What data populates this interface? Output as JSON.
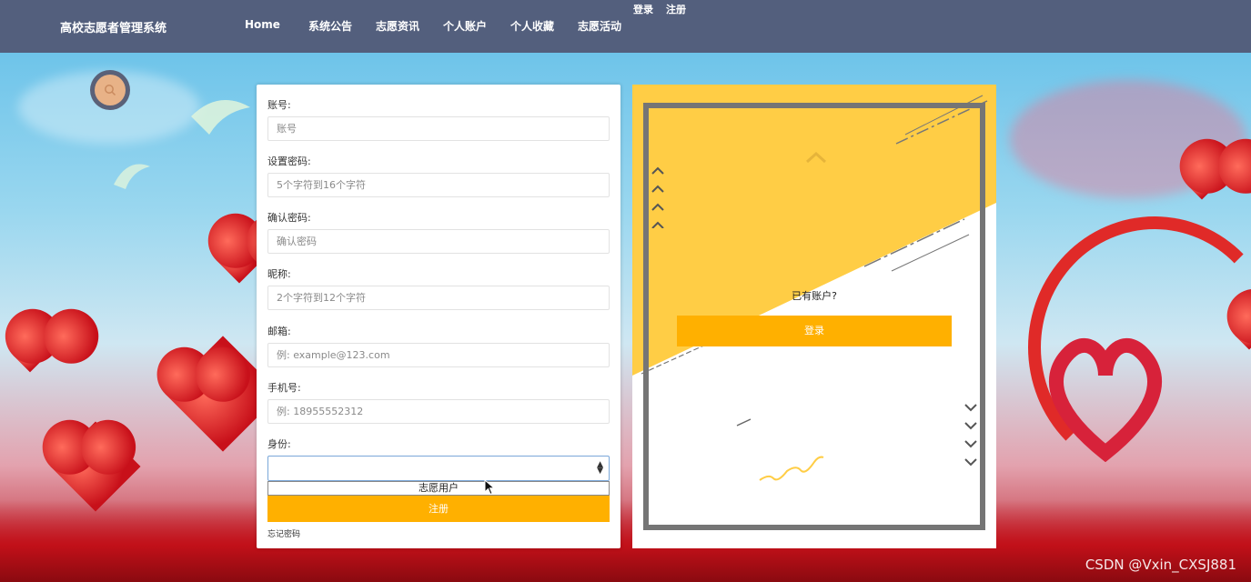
{
  "app": {
    "title": "高校志愿者管理系统"
  },
  "nav": {
    "items": [
      "Home",
      "系统公告",
      "志愿资讯",
      "个人账户",
      "个人收藏",
      "志愿活动"
    ],
    "auth": [
      "登录",
      "注册"
    ]
  },
  "form": {
    "fields": [
      {
        "label": "账号:",
        "placeholder": "账号"
      },
      {
        "label": "设置密码:",
        "placeholder": "5个字符到16个字符"
      },
      {
        "label": "确认密码:",
        "placeholder": "确认密码"
      },
      {
        "label": "昵称:",
        "placeholder": "2个字符到12个字符"
      },
      {
        "label": "邮箱:",
        "placeholder": "例: example@123.com"
      },
      {
        "label": "手机号:",
        "placeholder": "例: 18955552312"
      }
    ],
    "identity_label": "身份:",
    "identity_selected": "",
    "identity_options": [
      "志愿用户"
    ],
    "register_label": "注册",
    "forgot_label": "忘记密码"
  },
  "panel": {
    "has_account": "已有账户?",
    "login_label": "登录"
  },
  "watermark": "CSDN @Vxin_CXSJ881",
  "colors": {
    "topbar": "#535f7d",
    "accent": "#ffb000",
    "panel_yellow": "#ffcd45",
    "frame": "#757575"
  }
}
